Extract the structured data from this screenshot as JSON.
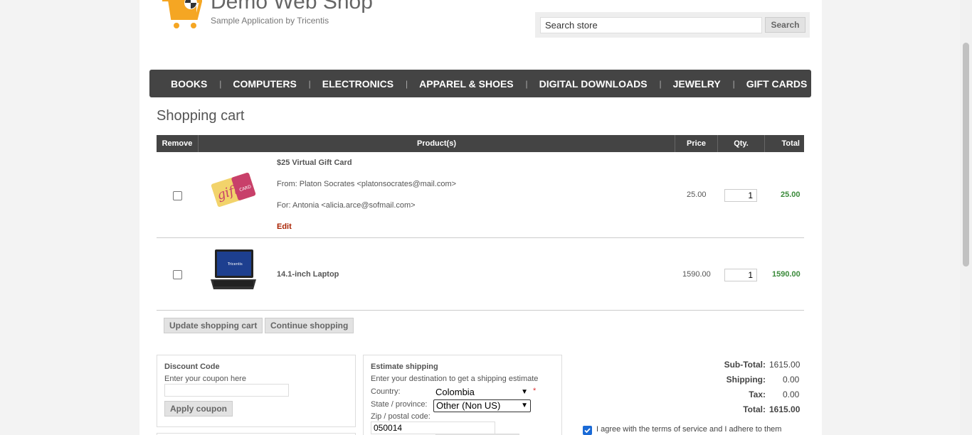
{
  "header": {
    "logo_title": "Demo Web Shop",
    "logo_subtitle": "Sample Application by Tricentis",
    "search_placeholder": "Search store",
    "search_button": "Search"
  },
  "nav": [
    "BOOKS",
    "COMPUTERS",
    "ELECTRONICS",
    "APPAREL & SHOES",
    "DIGITAL DOWNLOADS",
    "JEWELRY",
    "GIFT CARDS"
  ],
  "page_title": "Shopping cart",
  "table": {
    "headers": {
      "remove": "Remove",
      "product": "Product(s)",
      "price": "Price",
      "qty": "Qty.",
      "total": "Total"
    },
    "rows": [
      {
        "name": "$25 Virtual Gift Card",
        "from": "From: Platon Socrates <platonsocrates@mail.com>",
        "for": "For: Antonia <alicia.arce@sofmail.com>",
        "edit": "Edit",
        "price": "25.00",
        "qty": "1",
        "total": "25.00",
        "image_icon": "gift-card-image",
        "image_text": "gift CARD"
      },
      {
        "name": "14.1-inch Laptop",
        "price": "1590.00",
        "qty": "1",
        "total": "1590.00",
        "image_icon": "laptop-image",
        "image_text": "Tricentis"
      }
    ]
  },
  "buttons": {
    "update": "Update shopping cart",
    "continue": "Continue shopping"
  },
  "discount": {
    "title": "Discount Code",
    "hint": "Enter your coupon here",
    "button": "Apply coupon"
  },
  "shipping": {
    "title": "Estimate shipping",
    "hint": "Enter your destination to get a shipping estimate",
    "country_label": "Country:",
    "country_value": "Colombia",
    "state_label": "State / province:",
    "state_value": "Other (Non US)",
    "zip_label": "Zip / postal code:",
    "zip_value": "050014"
  },
  "totals": {
    "subtotal_label": "Sub-Total:",
    "subtotal": "1615.00",
    "shipping_label": "Shipping:",
    "shipping": "0.00",
    "tax_label": "Tax:",
    "tax": "0.00",
    "total_label": "Total:",
    "total": "1615.00"
  },
  "terms": "I agree with the terms of service and I adhere to them",
  "colors": {
    "nav_bg": "#444444",
    "accent": "#3a8a3a",
    "link": "#aa2200",
    "checkbox": "#1a6ad6"
  }
}
